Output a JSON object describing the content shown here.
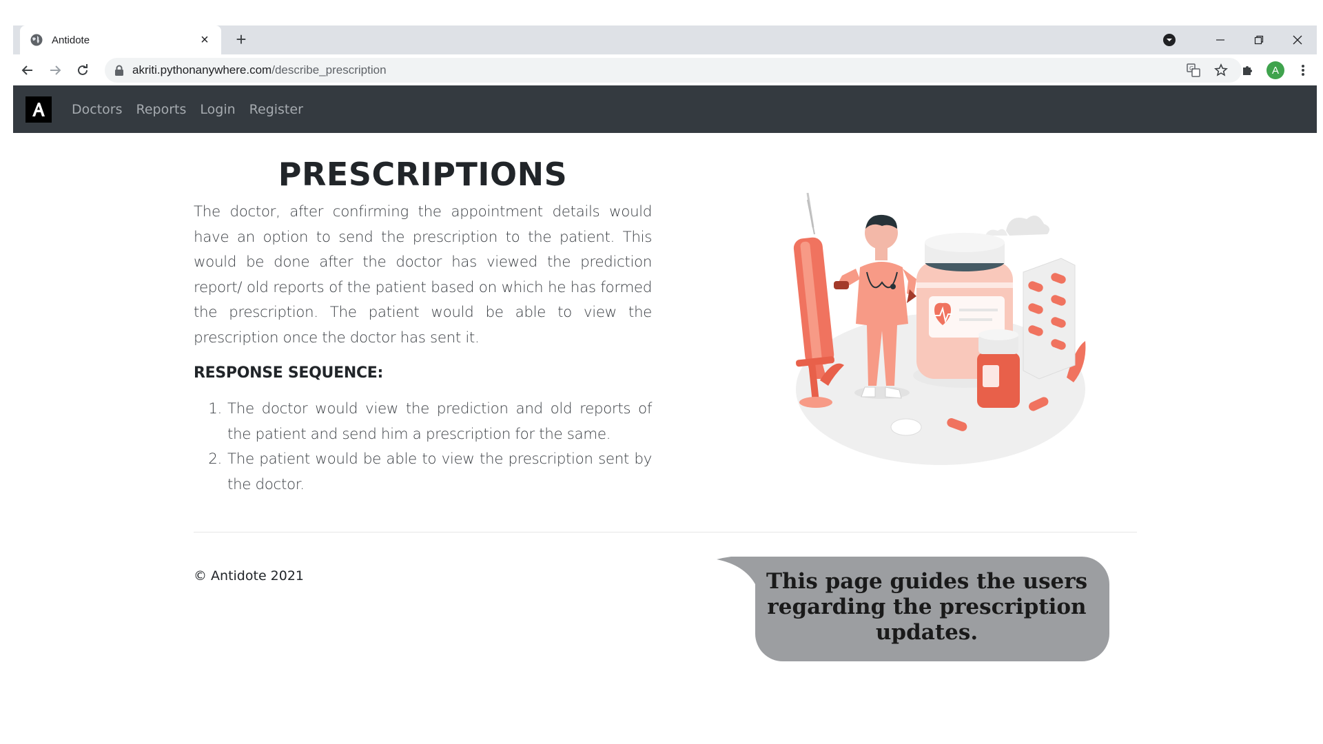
{
  "browser": {
    "tab_title": "Antidote",
    "url_host": "akriti.pythonanywhere.com",
    "url_path": "/describe_prescription",
    "profile_initial": "A"
  },
  "site_nav": {
    "links": [
      {
        "label": "Doctors"
      },
      {
        "label": "Reports"
      },
      {
        "label": "Login"
      },
      {
        "label": "Register"
      }
    ]
  },
  "main": {
    "title": "PRESCRIPTIONS",
    "intro": "The doctor, after confirming the appointment details would have an option to send the prescription to the patient. This would be done after the doctor has viewed the prediction report/ old reports of the patient based on which he has formed the prescription. The patient would be able to view the prescription once the doctor has sent it.",
    "sequence_heading": "RESPONSE SEQUENCE:",
    "sequence": [
      {
        "num": "1.",
        "text": "The doctor would view the prediction and old reports of the patient and send him a prescription for the same."
      },
      {
        "num": "2.",
        "text": "The patient would be able to view the prescription sent by the doctor."
      }
    ]
  },
  "footer": {
    "text": "© Antidote 2021"
  },
  "callout": {
    "text": "This page guides the users regarding the prescription updates."
  },
  "colors": {
    "navbar": "#343a40",
    "accent_coral": "#f0735f",
    "callout_bg": "#9c9ea1"
  }
}
